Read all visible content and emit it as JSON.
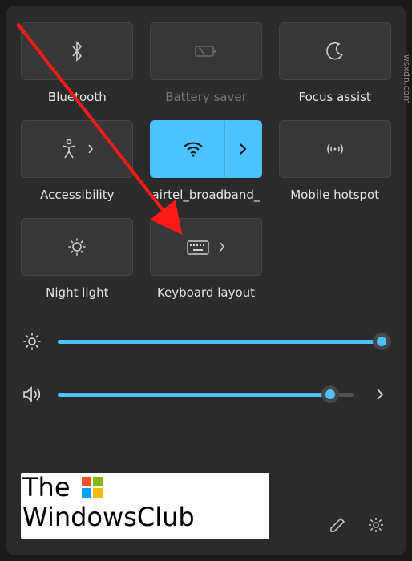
{
  "tiles": {
    "bluetooth": {
      "label": "Bluetooth",
      "icon": "bluetooth-icon"
    },
    "battery": {
      "label": "Battery saver",
      "icon": "battery-saver-icon",
      "disabled": true
    },
    "focus": {
      "label": "Focus assist",
      "icon": "moon-icon"
    },
    "accessibility": {
      "label": "Accessibility",
      "icon": "accessibility-icon",
      "hasChevron": true
    },
    "wifi": {
      "label": "airtel_broadband_",
      "icon": "wifi-icon",
      "active": true,
      "hasChevron": true
    },
    "hotspot": {
      "label": "Mobile hotspot",
      "icon": "hotspot-icon"
    },
    "nightlight": {
      "label": "Night light",
      "icon": "night-light-icon"
    },
    "keyboard": {
      "label": "Keyboard layout",
      "icon": "keyboard-icon",
      "hasChevron": true
    }
  },
  "sliders": {
    "brightness": {
      "percent": 97
    },
    "volume": {
      "percent": 92
    }
  },
  "watermark": {
    "line1": "The",
    "line2": "WindowsClub",
    "flag_colors": {
      "tl": "#f25022",
      "tr": "#7fba00",
      "bl": "#00a4ef",
      "br": "#ffb900"
    }
  },
  "footer": {
    "edit_icon": "pencil-icon",
    "settings_icon": "gear-icon"
  },
  "side_text": "wsxdn.com",
  "colors": {
    "accent": "#4cc2ff"
  }
}
